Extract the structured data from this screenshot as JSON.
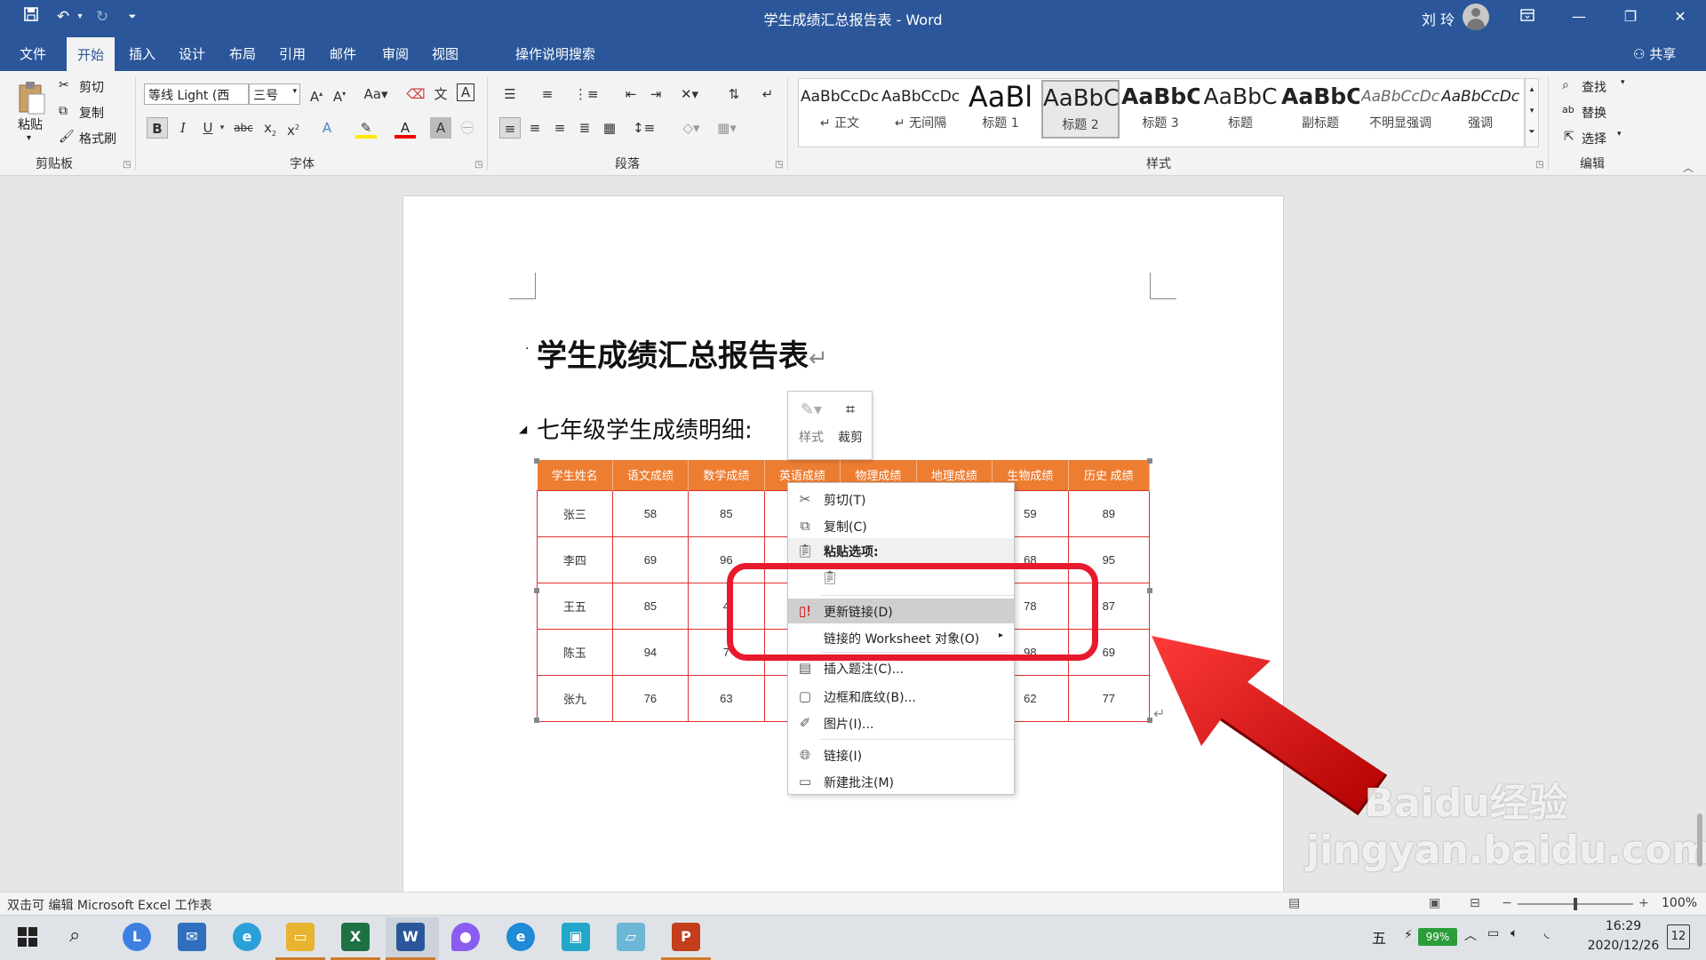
{
  "titlebar": {
    "document_title": "学生成绩汇总报告表",
    "separator": "-",
    "app_name": "Word",
    "user_name": "刘 玲"
  },
  "tabs": [
    "文件",
    "开始",
    "插入",
    "设计",
    "布局",
    "引用",
    "邮件",
    "审阅",
    "视图"
  ],
  "tell_me": "操作说明搜索",
  "share": "共享",
  "clipboard": {
    "paste": "粘贴",
    "cut": "剪切",
    "copy": "复制",
    "format_painter": "格式刷",
    "group_label": "剪贴板"
  },
  "font": {
    "name": "等线 Light (西",
    "size": "三号",
    "group_label": "字体"
  },
  "paragraph": {
    "group_label": "段落"
  },
  "styles": {
    "group_label": "样式",
    "items": [
      {
        "sample": "AaBbCcDc",
        "name": "↵ 正文"
      },
      {
        "sample": "AaBbCcDc",
        "name": "↵ 无间隔"
      },
      {
        "sample": "AaBl",
        "name": "标题 1"
      },
      {
        "sample": "AaBbC",
        "name": "标题 2"
      },
      {
        "sample": "AaBbC",
        "name": "标题 3"
      },
      {
        "sample": "AaBbC",
        "name": "标题"
      },
      {
        "sample": "AaBbC",
        "name": "副标题"
      },
      {
        "sample": "AaBbCcDc",
        "name": "不明显强调"
      },
      {
        "sample": "AaBbCcDc",
        "name": "强调"
      }
    ]
  },
  "editing": {
    "find": "查找",
    "replace": "替换",
    "select": "选择",
    "group_label": "编辑"
  },
  "document": {
    "heading1": "学生成绩汇总报告表",
    "heading2": "七年级学生成绩明细:",
    "table": {
      "headers": [
        "学生姓名",
        "语文成绩",
        "数学成绩",
        "英语成绩",
        "物理成绩",
        "地理成绩",
        "生物成绩",
        "历史 成绩"
      ],
      "rows": [
        [
          "张三",
          "58",
          "85",
          "",
          "",
          "",
          "59",
          "89"
        ],
        [
          "李四",
          "69",
          "96",
          "",
          "",
          "",
          "68",
          "95"
        ],
        [
          "王五",
          "85",
          "4",
          "",
          "",
          "",
          "78",
          "87"
        ],
        [
          "陈玉",
          "94",
          "7",
          "",
          "",
          "",
          "98",
          "69"
        ],
        [
          "张九",
          "76",
          "63",
          "",
          "",
          "",
          "62",
          "77"
        ]
      ]
    }
  },
  "mini_toolbar": {
    "style": "样式",
    "crop": "裁剪"
  },
  "context_menu": {
    "cut": "剪切(T)",
    "copy": "复制(C)",
    "paste_options": "粘贴选项:",
    "update_link": "更新链接(D)",
    "linked_object": "链接的 Worksheet 对象(O)",
    "insert_caption": "插入题注(C)...",
    "borders": "边框和底纹(B)...",
    "picture": "图片(I)...",
    "link": "链接(I)",
    "new_comment": "新建批注(M)"
  },
  "statusbar": {
    "text": "双击可 编辑 Microsoft Excel 工作表",
    "zoom": "100%"
  },
  "taskbar": {
    "ime": "五",
    "battery": "99%",
    "time": "16:29",
    "date": "2020/12/26",
    "notifications": "12"
  },
  "watermark": "Baidu经验 jingyan.baidu.com",
  "colors": {
    "word_blue": "#2b579a",
    "table_header": "#ed7d31",
    "highlight_red": "#e8192c"
  }
}
